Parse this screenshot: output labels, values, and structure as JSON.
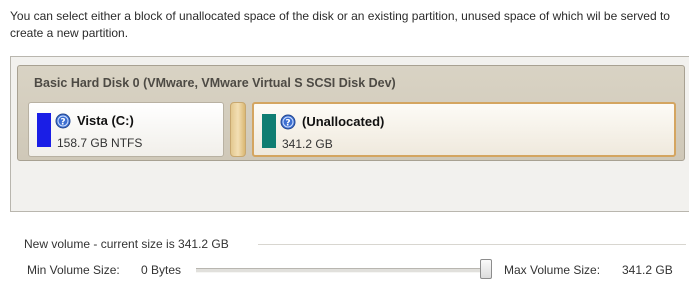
{
  "intro_text": "You can select either a block of unallocated space of the disk or an existing partition, unused space of which wil be served to create a new partition.",
  "disk": {
    "title": "Basic Hard Disk 0 (VMware, VMware Virtual S SCSI Disk Dev)",
    "partitions": [
      {
        "name": "Vista (C:)",
        "size": "158.7 GB NTFS",
        "color": "#1a1ee6",
        "icon": "help-icon",
        "selected": false
      },
      {
        "name": "(Unallocated)",
        "size": "341.2 GB",
        "color": "#0f7d72",
        "icon": "help-icon",
        "selected": true
      }
    ]
  },
  "new_volume": {
    "label": "New volume - current size is 341.2 GB",
    "min_label": "Min Volume Size:",
    "min_value": "0 Bytes",
    "max_label": "Max Volume Size:",
    "max_value": "341.2 GB",
    "slider_fraction": 1.0
  }
}
